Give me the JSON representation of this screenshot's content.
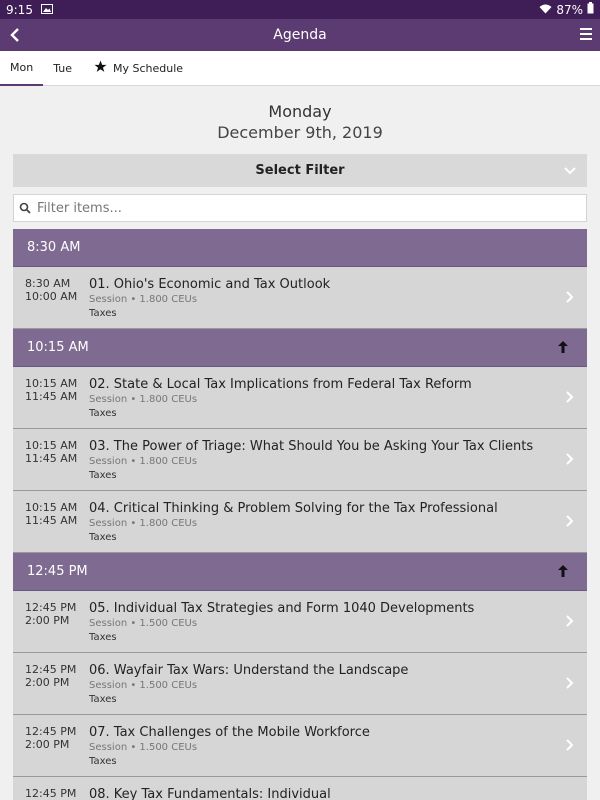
{
  "status_bar": {
    "time": "9:15",
    "battery": "87%"
  },
  "app_bar": {
    "title": "Agenda"
  },
  "tabs": [
    {
      "label": "Mon",
      "active": true
    },
    {
      "label": "Tue",
      "active": false
    },
    {
      "label": "My Schedule",
      "active": false
    }
  ],
  "day": {
    "name": "Monday",
    "date": "December 9th, 2019"
  },
  "filter": {
    "select_label": "Select Filter",
    "input_placeholder": "Filter items..."
  },
  "groups": [
    {
      "time": "8:30 AM",
      "sessions": [
        {
          "start": "8:30 AM",
          "end": "10:00 AM",
          "title": "01. Ohio's Economic and Tax Outlook",
          "meta": "Session • 1.800 CEUs",
          "track": "Taxes"
        }
      ]
    },
    {
      "time": "10:15 AM",
      "sessions": [
        {
          "start": "10:15 AM",
          "end": "11:45 AM",
          "title": "02. State & Local Tax Implications from Federal Tax Reform",
          "meta": "Session • 1.800 CEUs",
          "track": "Taxes"
        },
        {
          "start": "10:15 AM",
          "end": "11:45 AM",
          "title": "03. The Power of Triage: What Should You be Asking Your Tax Clients",
          "meta": "Session • 1.800 CEUs",
          "track": "Taxes"
        },
        {
          "start": "10:15 AM",
          "end": "11:45 AM",
          "title": "04. Critical Thinking & Problem Solving for the Tax Professional",
          "meta": "Session • 1.800 CEUs",
          "track": "Taxes"
        }
      ]
    },
    {
      "time": "12:45 PM",
      "sessions": [
        {
          "start": "12:45 PM",
          "end": "2:00 PM",
          "title": "05. Individual Tax Strategies and Form 1040 Developments",
          "meta": "Session • 1.500 CEUs",
          "track": "Taxes"
        },
        {
          "start": "12:45 PM",
          "end": "2:00 PM",
          "title": "06. Wayfair Tax Wars: Understand the Landscape",
          "meta": "Session • 1.500 CEUs",
          "track": "Taxes"
        },
        {
          "start": "12:45 PM",
          "end": "2:00 PM",
          "title": "07. Tax Challenges of the Mobile Workforce",
          "meta": "Session • 1.500 CEUs",
          "track": "Taxes"
        },
        {
          "start": "12:45 PM",
          "end": "",
          "title": "08. Key Tax Fundamentals: Individual",
          "meta": "",
          "track": ""
        }
      ]
    }
  ]
}
